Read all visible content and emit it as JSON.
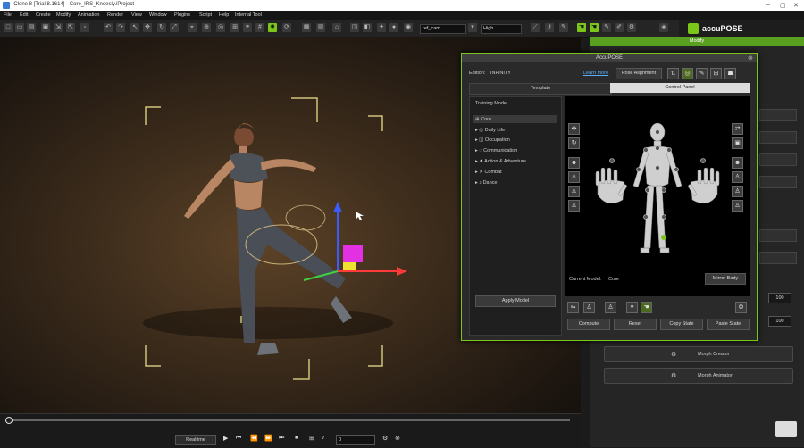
{
  "window": {
    "title": "iClone 8 [Trial 8.1614] - Core_IRS_Kneesly.iProject"
  },
  "menu": [
    "File",
    "Edit",
    "Create",
    "Modify",
    "Animation",
    "Render",
    "View",
    "Window",
    "Plugins",
    "Script",
    "Help",
    "Internal Tool"
  ],
  "toolbar": {
    "camera": "ref_cam",
    "quality": "High"
  },
  "right_panel": {
    "accupose_logo": "accuPOSE",
    "modify_tab": "Modify",
    "spin_value_1": "100",
    "spin_value_2": "100",
    "morph_creator": "Morph Creator",
    "morph_animator": "Morph Animator"
  },
  "accupose": {
    "title": "AccuPOSE",
    "edition_label": "Edition:",
    "edition_value": "INFINITY",
    "learn_more": "Learn more",
    "pose_alignment": "Pose Alignment",
    "tab_template": "Template",
    "tab_control_panel": "Control Panel",
    "training_model_label": "Training Model",
    "training_models": [
      "Core",
      "Daily Life",
      "Occupation",
      "Communication",
      "Action & Adventure",
      "Combat",
      "Dance"
    ],
    "apply_model": "Apply Model",
    "current_model_label": "Current Model:",
    "current_model_value": "Core",
    "mirror_body": "Mirror Body",
    "compute": "Compute",
    "reset": "Reset",
    "copy_state": "Copy State",
    "paste_state": "Paste State"
  },
  "timeline": {
    "realtime": "Realtime",
    "frame": "0"
  },
  "colors": {
    "accent": "#7cc61a",
    "modify_bar": "#5aa020"
  },
  "icons": [
    "app-icon",
    "new-icon",
    "open-icon",
    "save-icon",
    "select-icon",
    "move-icon",
    "rotate-icon",
    "camera-icon",
    "play-icon",
    "stop-icon",
    "previous-icon",
    "next-icon",
    "gizmo-icon",
    "hand-icon",
    "body-icon",
    "close-icon"
  ]
}
